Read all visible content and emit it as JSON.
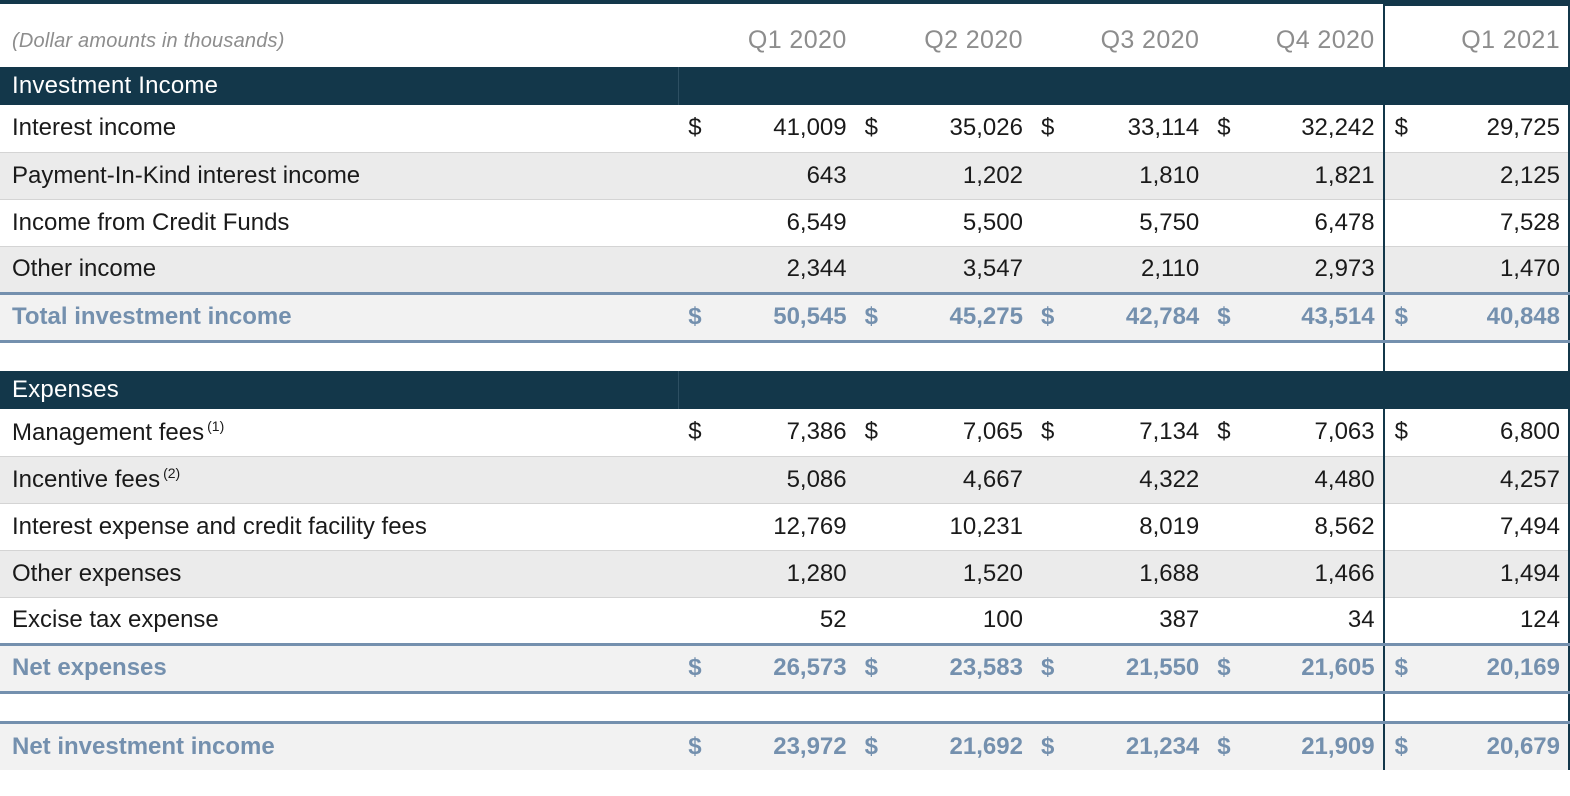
{
  "header": {
    "note": "(Dollar amounts in thousands)",
    "columns": [
      "Q1 2020",
      "Q2 2020",
      "Q3 2020",
      "Q4 2020",
      "Q1 2021"
    ],
    "highlight_column": "Q1 2021"
  },
  "colors": {
    "band": "#13374a",
    "total_text": "#7490ae",
    "alt_row": "#ebebeb",
    "header_text": "#8d8d8d",
    "body_text": "#1a1a1a",
    "highlight_border": "#13374a"
  },
  "currency_symbol": "$",
  "sections": [
    {
      "title": "Investment Income",
      "rows": [
        {
          "label": "Interest income",
          "note": "",
          "show_currency": true,
          "values": [
            "41,009",
            "35,026",
            "33,114",
            "32,242",
            "29,725"
          ]
        },
        {
          "label": "Payment-In-Kind interest income",
          "note": "",
          "show_currency": false,
          "values": [
            "643",
            "1,202",
            "1,810",
            "1,821",
            "2,125"
          ]
        },
        {
          "label": "Income from Credit Funds",
          "note": "",
          "show_currency": false,
          "values": [
            "6,549",
            "5,500",
            "5,750",
            "6,478",
            "7,528"
          ]
        },
        {
          "label": "Other income",
          "note": "",
          "show_currency": false,
          "values": [
            "2,344",
            "3,547",
            "2,110",
            "2,973",
            "1,470"
          ]
        }
      ],
      "total": {
        "label": "Total investment income",
        "show_currency": true,
        "values": [
          "50,545",
          "45,275",
          "42,784",
          "43,514",
          "40,848"
        ]
      }
    },
    {
      "title": "Expenses",
      "rows": [
        {
          "label": "Management fees",
          "note": "(1)",
          "show_currency": true,
          "values": [
            "7,386",
            "7,065",
            "7,134",
            "7,063",
            "6,800"
          ]
        },
        {
          "label": "Incentive fees",
          "note": "(2)",
          "show_currency": false,
          "values": [
            "5,086",
            "4,667",
            "4,322",
            "4,480",
            "4,257"
          ]
        },
        {
          "label": "Interest expense and credit facility fees",
          "note": "",
          "show_currency": false,
          "values": [
            "12,769",
            "10,231",
            "8,019",
            "8,562",
            "7,494"
          ]
        },
        {
          "label": "Other expenses",
          "note": "",
          "show_currency": false,
          "values": [
            "1,280",
            "1,520",
            "1,688",
            "1,466",
            "1,494"
          ]
        },
        {
          "label": "Excise tax expense",
          "note": "",
          "show_currency": false,
          "values": [
            "52",
            "100",
            "387",
            "34",
            "124"
          ]
        }
      ],
      "total": {
        "label": "Net expenses",
        "show_currency": true,
        "values": [
          "26,573",
          "23,583",
          "21,550",
          "21,605",
          "20,169"
        ]
      }
    }
  ],
  "grand_total": {
    "label": "Net investment income",
    "show_currency": true,
    "values": [
      "23,972",
      "21,692",
      "21,234",
      "21,909",
      "20,679"
    ]
  }
}
